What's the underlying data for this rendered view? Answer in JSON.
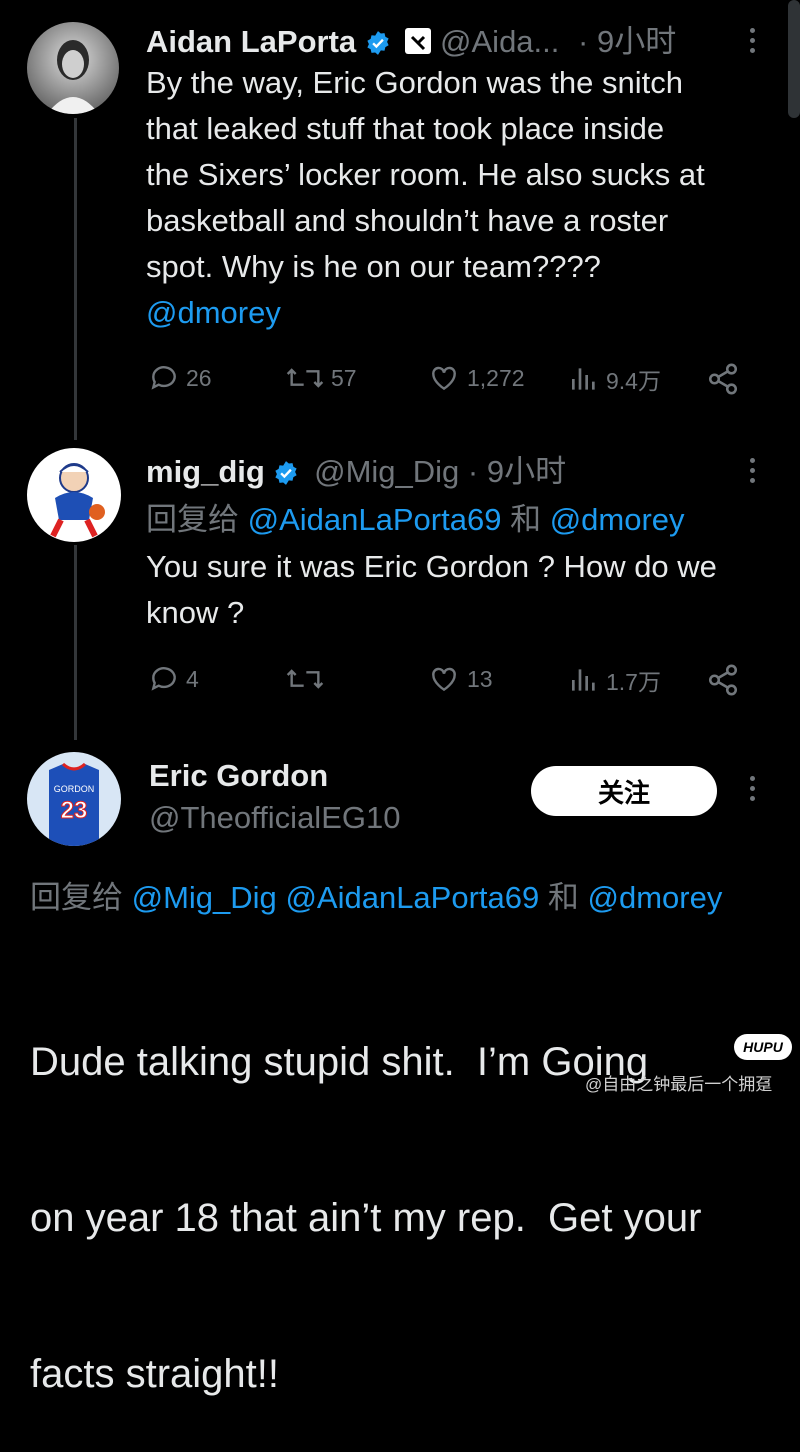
{
  "tweets": [
    {
      "name": "Aidan LaPorta",
      "handle": "@Aida...",
      "time": "· 9小时",
      "text_lines": [
        "By the way, Eric Gordon was the snitch",
        "that leaked stuff that took place inside",
        "the Sixers’ locker room. He also sucks at",
        "basketball and shouldn’t have a roster",
        "spot. Why is he on our team????"
      ],
      "mention": "@dmorey",
      "stats": {
        "replies": "26",
        "retweets": "57",
        "likes": "1,272",
        "views": "9.4万"
      }
    },
    {
      "name": "mig_dig",
      "handle": "@Mig_Dig",
      "time": "· 9小时",
      "reply_prefix": "回复给",
      "reply_to_1": "@AidanLaPorta69",
      "reply_and": "和",
      "reply_to_2": "@dmorey",
      "text_lines": [
        "You sure it was Eric Gordon ? How do we",
        "know ?"
      ],
      "stats": {
        "replies": "4",
        "retweets": "",
        "likes": "13",
        "views": "1.7万"
      }
    },
    {
      "name": "Eric Gordon",
      "handle": "@TheofficialEG10",
      "avatar_number": "23",
      "avatar_text": "GORDON",
      "follow_label": "关注",
      "reply_prefix": "回复给",
      "reply_to_1": "@Mig_Dig",
      "reply_to_2": "@AidanLaPorta69",
      "reply_and": "和",
      "reply_to_3": "@dmorey",
      "text_lines": [
        "Dude talking stupid shit.  I’m Going",
        "on year 18 that ain’t my rep.  Get your",
        "facts straight!!"
      ]
    }
  ],
  "watermark": {
    "logo": "HUPU",
    "caption": "@自由之钟最后一个拥趸"
  },
  "colors": {
    "accent": "#1d9bf0",
    "muted": "#71767b",
    "background": "#000000"
  },
  "icons": [
    "reply-icon",
    "retweet-icon",
    "like-icon",
    "views-icon",
    "share-icon",
    "verified-icon",
    "more-icon"
  ]
}
